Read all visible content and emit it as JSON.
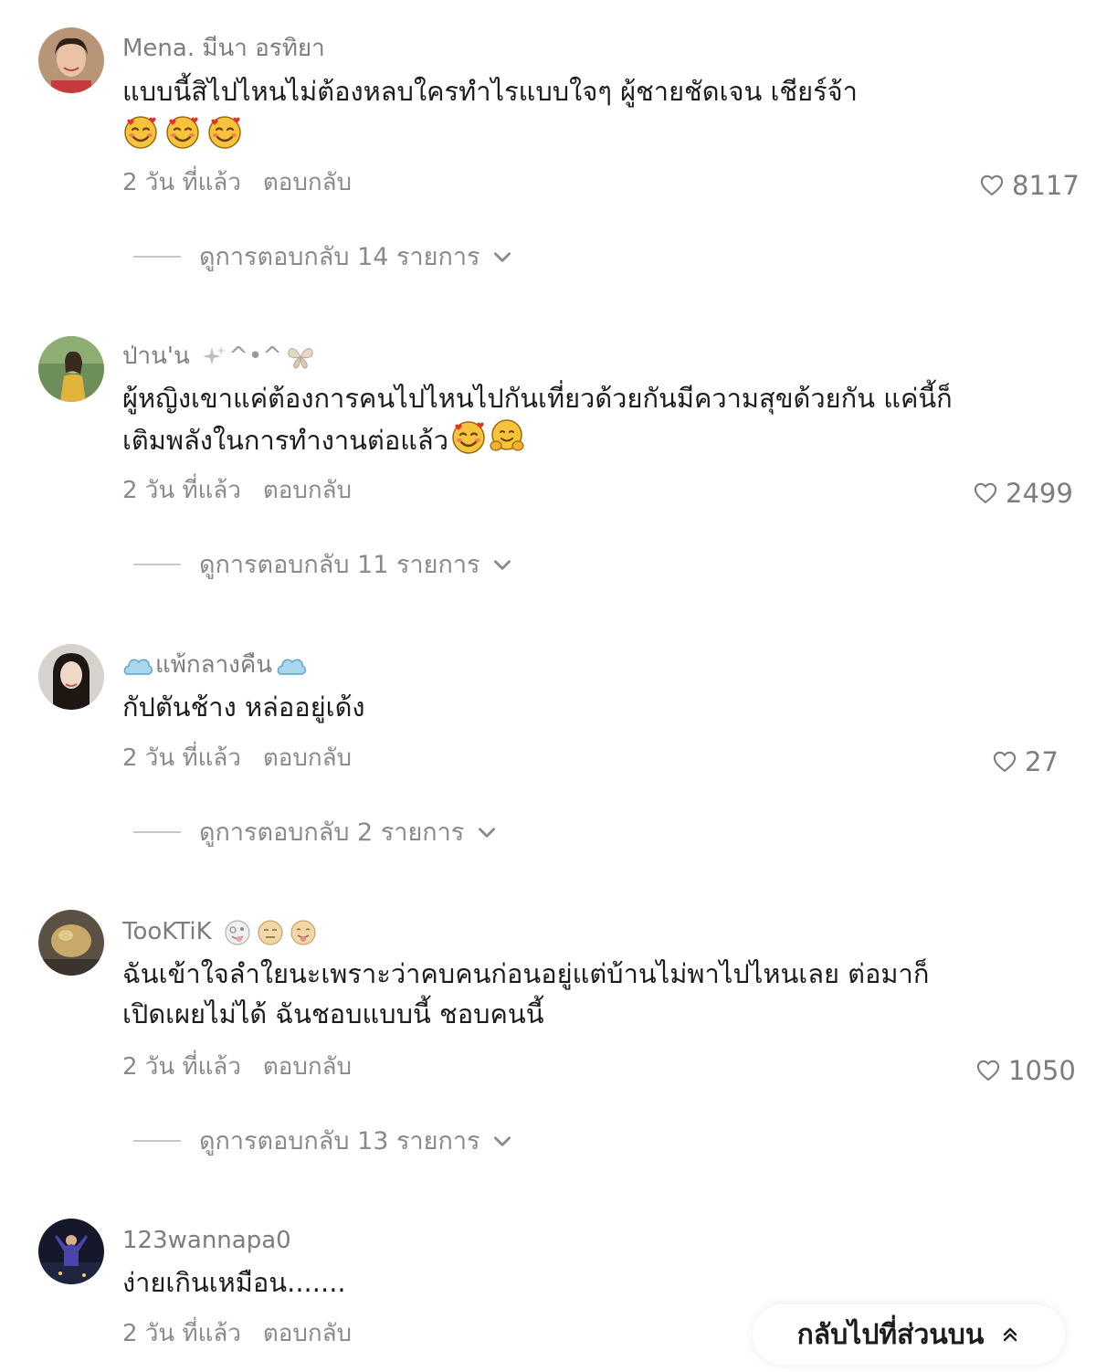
{
  "comments": [
    {
      "username": "Mena. มีนา อรทิยา",
      "text": "แบบนี้สิไปไหนไม่ต้องหลบใครทำไรแบบใจๆ ผู้ชายชัดเจน เชียร์จ้า",
      "emojis": [
        "smiling-face-with-hearts",
        "smiling-face-with-hearts",
        "smiling-face-with-hearts"
      ],
      "time": "2 วัน ที่แล้ว",
      "reply_label": "ตอบกลับ",
      "likes": "8117",
      "view_replies": "ดูการตอบกลับ 14 รายการ"
    },
    {
      "username": "ป่าน'น",
      "username_emojis": [
        "sparkles",
        "^•^",
        "butterfly"
      ],
      "text": "ผู้หญิงเขาแค่ต้องการคนไปไหนไปกันเที่ยวด้วยกันมีความสุขด้วยกัน แค่นี้ก็เติมพลังในการทำงานต่อแล้ว",
      "emojis": [
        "smiling-face-with-hearts",
        "hugging-face"
      ],
      "time": "2 วัน ที่แล้ว",
      "reply_label": "ตอบกลับ",
      "likes": "2499",
      "view_replies": "ดูการตอบกลับ 11 รายการ"
    },
    {
      "username": "แพ้กลางคืน",
      "username_emojis": [
        "cloud",
        "cloud"
      ],
      "text": "กัปตันช้าง หล่ออยู่เด้ง",
      "time": "2 วัน ที่แล้ว",
      "reply_label": "ตอบกลับ",
      "likes": "27",
      "view_replies": "ดูการตอบกลับ 2 รายการ"
    },
    {
      "username": "TooKTiK",
      "username_emojis": [
        "zany-face",
        "expressionless-face",
        "face-with-tongue"
      ],
      "text": "ฉันเข้าใจลำใยนะเพราะว่าคบคนก่อนอยู่แต่บ้านไม่พาไปไหนเลย ต่อมาก็เปิดเผยไม่ได้ ฉันชอบแบบนี้ ชอบคนนี้",
      "time": "2 วัน ที่แล้ว",
      "reply_label": "ตอบกลับ",
      "likes": "1050",
      "view_replies": "ดูการตอบกลับ 13 รายการ"
    },
    {
      "username": "123wannapa0",
      "text": "ง่ายเกินเหมือน.......",
      "time": "2 วัน ที่แล้ว",
      "reply_label": "ตอบกลับ"
    }
  ],
  "back_to_top": "กลับไปที่ส่วนบน",
  "icons": {
    "like": "heart-outline-icon",
    "expand": "chevron-down-icon",
    "back_to_top": "double-chevron-up-icon"
  },
  "colors": {
    "username": "#7d7d7d",
    "text": "#1c1c1c",
    "meta": "#8a8a8a",
    "background": "#ffffff"
  }
}
